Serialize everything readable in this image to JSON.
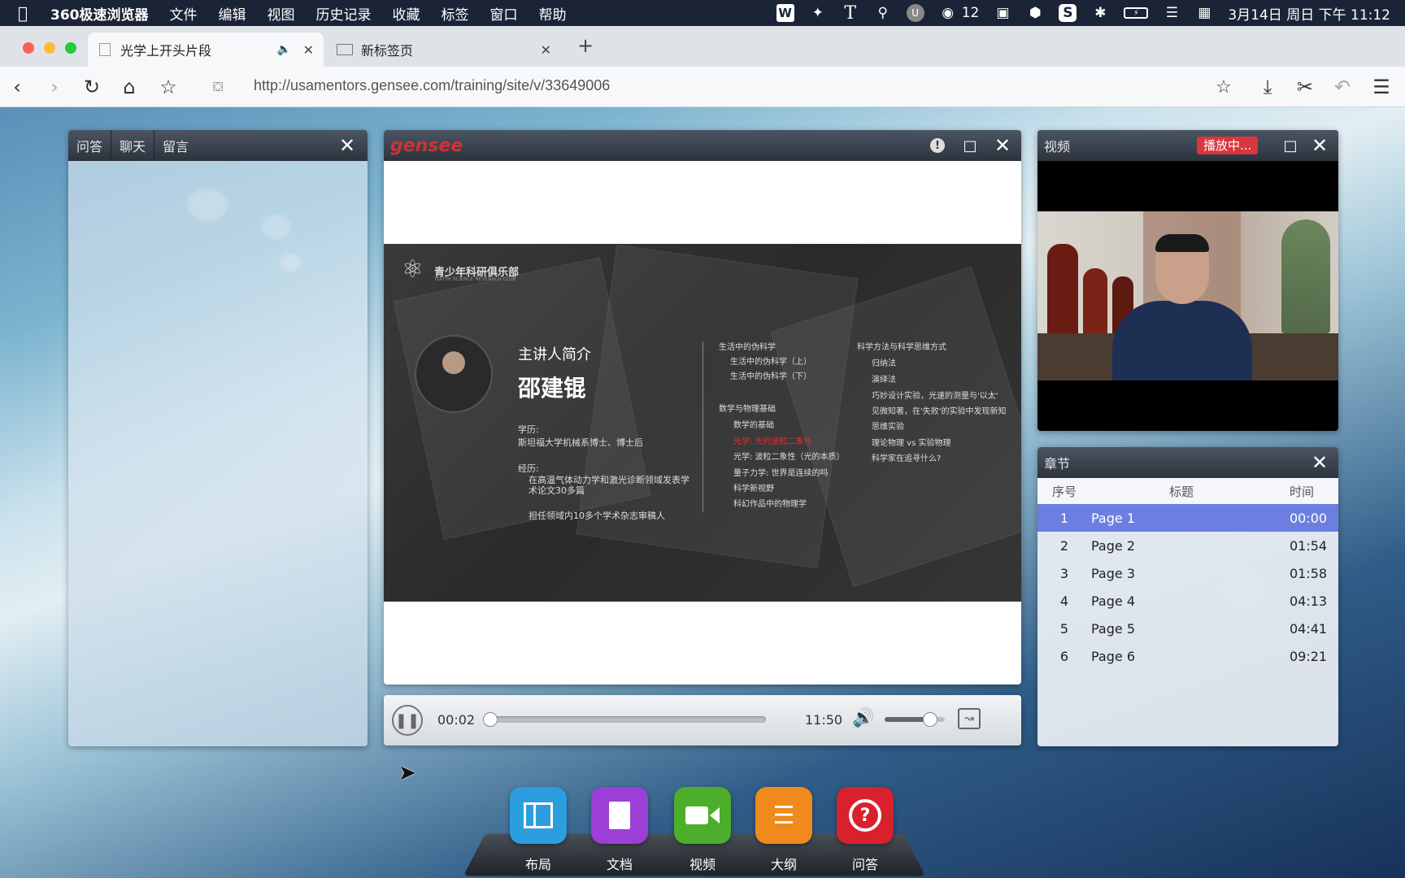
{
  "menubar": {
    "app_name": "360极速浏览器",
    "items": [
      "文件",
      "编辑",
      "视图",
      "历史记录",
      "收藏",
      "标签",
      "窗口",
      "帮助"
    ],
    "wechat_count": "12",
    "datetime": "3月14日 周日 下午 11:12"
  },
  "tabs": [
    {
      "title": "光学上开头片段",
      "active": true
    },
    {
      "title": "新标签页",
      "active": false
    }
  ],
  "address": {
    "url": "http://usamentors.gensee.com/training/site/v/33649006"
  },
  "qa_panel": {
    "tabs": [
      "问答",
      "聊天",
      "留言"
    ]
  },
  "doc_panel": {
    "logo": "gensee",
    "slide": {
      "club_name": "青少年科研俱乐部",
      "club_sub": "YOUTH SCIENCE RESEARCH CLUB",
      "intro_title": "主讲人简介",
      "speaker": "邵建锟",
      "edu_label": "学历:",
      "edu": "斯坦福大学机械系博士、博士后",
      "exp_label": "经历:",
      "exp1": "在高温气体动力学和激光诊断领域发表学术论文30多篇",
      "exp2": "担任领域内10多个学术杂志审稿人",
      "col1_head": "生活中的伪科学",
      "col1_items": [
        "生活中的伪科学（上）",
        "生活中的伪科学（下）"
      ],
      "col2_head": "数学与物理基础",
      "col2_items": [
        "数学的基础",
        "光学: 光的波粒二象性",
        "光学: 波粒二象性（光的本质）",
        "量子力学: 世界是连续的吗",
        "科学新视野",
        "科幻作品中的物理学"
      ],
      "col3_head": "科学方法与科学思维方式",
      "col3_items": [
        "归纳法",
        "演绎法",
        "巧妙设计实验，光速的测量与'以太'",
        "见微知著，在'失败'的实验中发现新知",
        "思维实验",
        "理论物理 vs 实验物理",
        "科学家在追寻什么?"
      ]
    }
  },
  "player": {
    "current_time": "00:02",
    "duration": "11:50",
    "progress": 0.003,
    "volume": 0.75
  },
  "video_panel": {
    "title": "视频",
    "status": "播放中..."
  },
  "chapter_panel": {
    "title": "章节",
    "columns": [
      "序号",
      "标题",
      "时间"
    ],
    "rows": [
      {
        "no": "1",
        "title": "Page 1",
        "time": "00:00"
      },
      {
        "no": "2",
        "title": "Page 2",
        "time": "01:54"
      },
      {
        "no": "3",
        "title": "Page 3",
        "time": "01:58"
      },
      {
        "no": "4",
        "title": "Page 4",
        "time": "04:13"
      },
      {
        "no": "5",
        "title": "Page 5",
        "time": "04:41"
      },
      {
        "no": "6",
        "title": "Page 6",
        "time": "09:21"
      }
    ]
  },
  "dock": [
    {
      "label": "布局",
      "color": "#2c9ee0"
    },
    {
      "label": "文档",
      "color": "#9b3fd6"
    },
    {
      "label": "视频",
      "color": "#4cae2a"
    },
    {
      "label": "大纲",
      "color": "#f08a1c"
    },
    {
      "label": "问答",
      "color": "#d8212d"
    }
  ]
}
